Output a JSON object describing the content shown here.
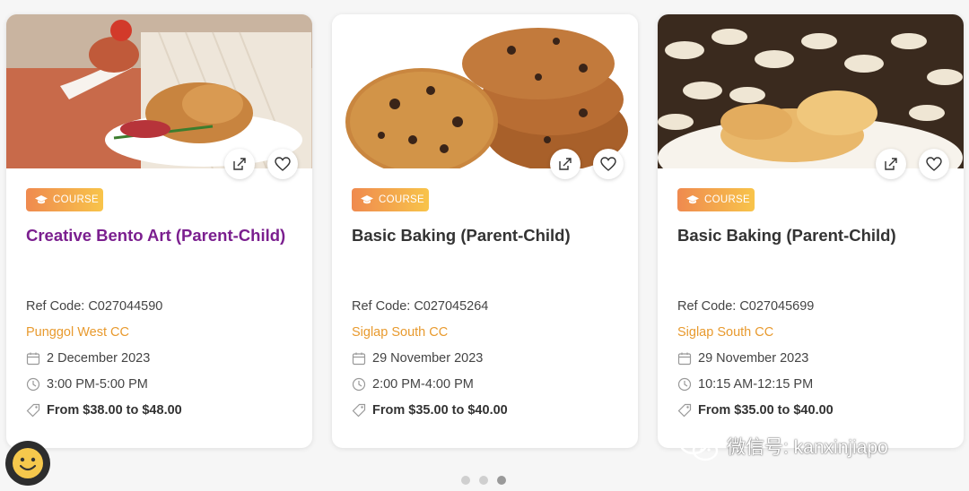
{
  "colors": {
    "title_active": "#7b1f8f",
    "venue": "#e89a2e",
    "badge_gradient": [
      "#ef8a4f",
      "#f8c44a"
    ]
  },
  "cards": [
    {
      "badge": "COURSE",
      "title": "Creative Bento Art (Parent-Child)",
      "ref": "Ref Code: C027044590",
      "venue": "Punggol West CC",
      "date": "2 December 2023",
      "time": "3:00 PM-5:00 PM",
      "price": "From $38.00 to $48.00",
      "image": "bento-dish-photo"
    },
    {
      "badge": "COURSE",
      "title": "Basic Baking (Parent-Child)",
      "ref": "Ref Code: C027045264",
      "venue": "Siglap South CC",
      "date": "29 November 2023",
      "time": "2:00 PM-4:00 PM",
      "price": "From $35.00 to $40.00",
      "image": "chocolate-chip-cookies-photo"
    },
    {
      "badge": "COURSE",
      "title": "Basic Baking (Parent-Child)",
      "ref": "Ref Code: C027045699",
      "venue": "Siglap South CC",
      "date": "29 November 2023",
      "time": "10:15 AM-12:15 PM",
      "price": "From $35.00 to $40.00",
      "image": "cashew-cookies-photo"
    }
  ],
  "pagination": {
    "total": 3,
    "active_index": 2
  },
  "watermark": {
    "text": "微信号: kanxinjiapo"
  }
}
